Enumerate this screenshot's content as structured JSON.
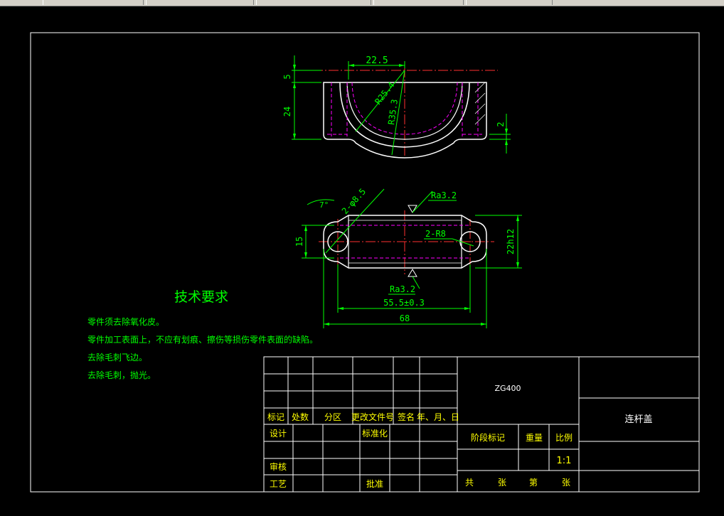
{
  "colors": {
    "background": "#000000",
    "frame": "#ffffff",
    "outline": "#ffffff",
    "dimension": "#00ff00",
    "center_line": "#ff3030",
    "hidden_line": "#ff00ff",
    "title_text": "#ffff00",
    "notes_text": "#00ff00"
  },
  "front_view": {
    "dim_width": "22.5",
    "dim_top": "5",
    "dim_height": "24",
    "dim_right": "2",
    "radius_inner": "R25.4",
    "radius_outer": "R35.3"
  },
  "top_view": {
    "holes": "2-φ8.5",
    "chamfer": "7°",
    "roughness_top": "Ra3.2",
    "roughness_bottom": "Ra3.2",
    "ends_radius": "2-R8",
    "width_dim": "15",
    "height_dim": "22h12",
    "hole_spacing": "55.5±0.3",
    "overall_length": "68"
  },
  "notes": {
    "title": "技术要求",
    "items": [
      "零件须去除氧化皮。",
      "零件加工表面上，不应有划痕、擦伤等损伤零件表面的缺陷。",
      "去除毛刺飞边。",
      "去除毛刺，抛光。"
    ]
  },
  "title_block": {
    "material": "ZG400",
    "part_name": "连杆盖",
    "rev_headers": [
      "标记",
      "处数",
      "分区",
      "更改文件号",
      "签名",
      "年、月、日"
    ],
    "design": "设计",
    "standardize": "标准化",
    "review": "审核",
    "process": "工艺",
    "approve": "批准",
    "stage_mark": "阶段标记",
    "weight": "重量",
    "scale_label": "比例",
    "scale_value": "1:1",
    "total": "共",
    "sheet": "张",
    "page": "第",
    "sheet2": "张"
  }
}
